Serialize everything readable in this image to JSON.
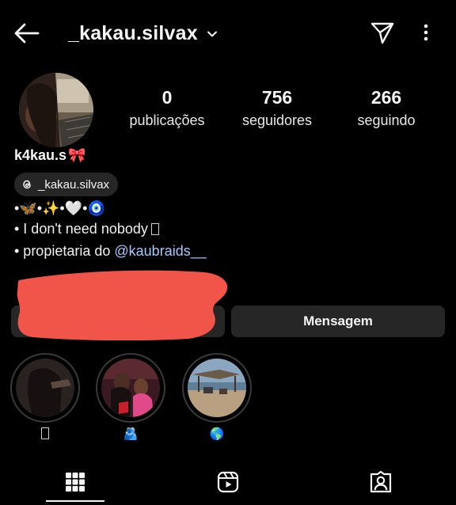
{
  "header": {
    "username": "_kakau.silvax",
    "back_icon": "arrow-left-icon",
    "dropdown_icon": "chevron-down-icon",
    "send_icon": "paper-plane-icon",
    "more_icon": "more-vertical-icon"
  },
  "stats": [
    {
      "value": "0",
      "label": "publicações"
    },
    {
      "value": "756",
      "label": "seguidores"
    },
    {
      "value": "266",
      "label": "seguindo"
    }
  ],
  "profile": {
    "display_name": "k4kau.s",
    "display_name_emoji": "🎀",
    "threads_handle": "_kakau.silvax",
    "bio_line1": "•🦋•✨•🤍•🧿",
    "bio_line2_prefix": "• I don't need nobody",
    "bio_line3_prefix": "• propietaria do ",
    "bio_line3_mention": "@kaubraids__"
  },
  "buttons": {
    "message_label": "Mensagem"
  },
  "highlights": [
    {
      "label": ""
    },
    {
      "label": "🫂"
    },
    {
      "label": "🌎"
    }
  ],
  "tabs": [
    {
      "icon": "grid-icon"
    },
    {
      "icon": "reels-icon"
    },
    {
      "icon": "tagged-icon"
    }
  ],
  "colors": {
    "background": "#000000",
    "button_bg": "#262626",
    "mention": "#a5c8ff",
    "redaction": "#f1554a"
  }
}
